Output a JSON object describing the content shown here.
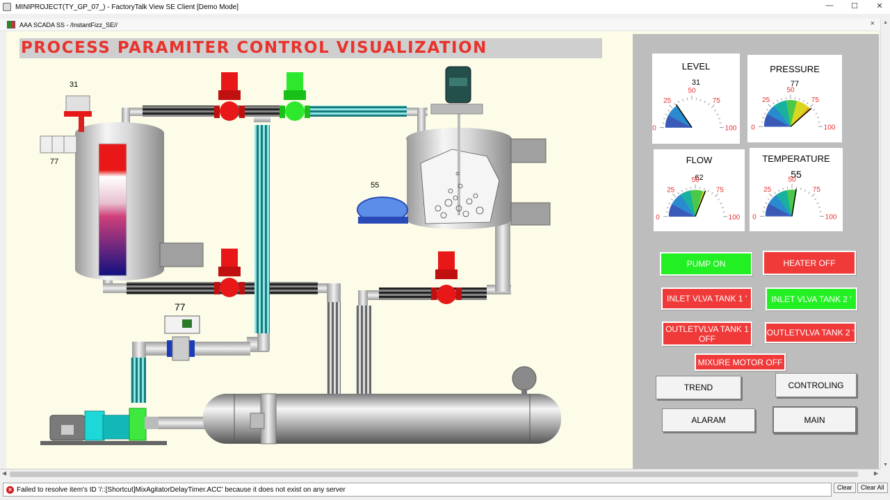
{
  "window": {
    "title": "MINIPROJECT(TY_GP_07_) - FactoryTalk View SE Client  [Demo Mode]",
    "controls": [
      "—",
      "☐",
      "✕"
    ]
  },
  "tab": {
    "label": "AAA SCADA SS - /InstantFizz_SE//",
    "close": "×"
  },
  "display": {
    "title": "PROCESS PARAMITER CONTROL VISUALIZATION",
    "values": {
      "tank1_top": "31",
      "tank1_side": "77",
      "pump_value": "55",
      "flow_meter": "77"
    }
  },
  "gauges": [
    {
      "title": "LEVEL",
      "value": "31",
      "reading": 31,
      "ticks": [
        "0",
        "25",
        "50",
        "75",
        "100"
      ]
    },
    {
      "title": "PRESSURE",
      "value": "77",
      "reading": 77,
      "ticks": [
        "0",
        "25",
        "50",
        "75",
        "100"
      ]
    },
    {
      "title": "FLOW",
      "value": "62",
      "reading": 62,
      "ticks": [
        "0",
        "25",
        "50",
        "75",
        "100"
      ]
    },
    {
      "title": "TEMPERATURE",
      "value": "55",
      "reading": 55,
      "ticks": [
        "0",
        "25",
        "50",
        "75",
        "100"
      ]
    }
  ],
  "buttons": {
    "pump": "PUMP ON",
    "heater": "HEATER OFF",
    "inlet1": "INLET VLVA TANK 1  '",
    "inlet2": "INLET VLVA TANK 2  '",
    "outlet1": "OUTLETVLVA TANK 1 OFF",
    "outlet2": "OUTLETVLVA TANK 2 '",
    "mixer": "MIXURE MOTOR OFF",
    "trend": "TREND",
    "controling": "CONTROLING",
    "alaram": "ALARAM",
    "main": "MAIN"
  },
  "status": {
    "message": "Failed to resolve item's ID '/::[Shortcut]MixAgitatorDelayTimer.ACC' because it does not exist on any server",
    "clear": "Clear",
    "clear_all": "Clear All"
  },
  "colors": {
    "title_red": "#e8332d",
    "button_red": "#f03a3a",
    "button_green": "#22f022",
    "valve_red": "#e81818",
    "valve_green": "#2ee82e",
    "canvas": "#fcfce8",
    "panel": "#bdbdbd"
  }
}
